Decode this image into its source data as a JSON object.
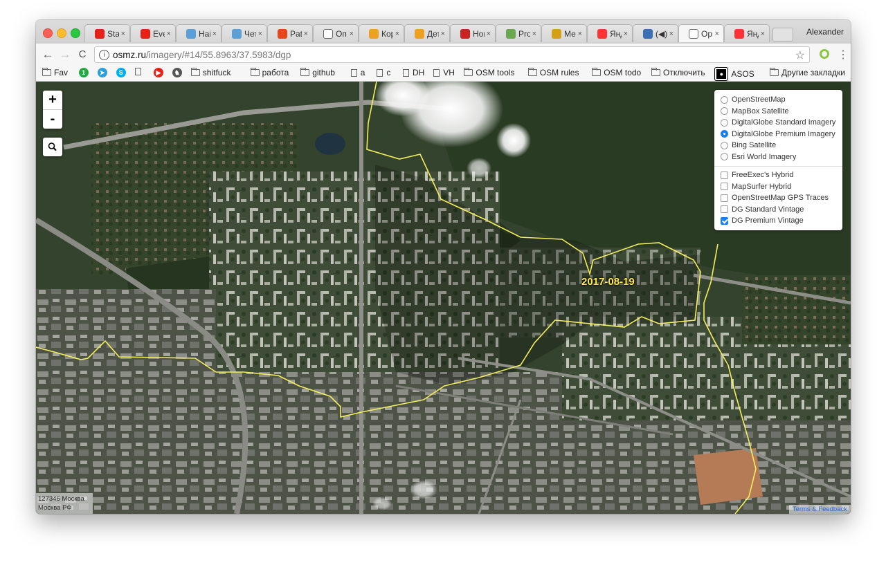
{
  "window": {
    "profile_name": "Alexander",
    "tabs": [
      {
        "title": "Sta",
        "icon": "youtube-icon",
        "color": "#e62117"
      },
      {
        "title": "Eve",
        "icon": "youtube-icon",
        "color": "#e62117"
      },
      {
        "title": "Hai",
        "icon": "hn-icon",
        "color": "#5aa0d8"
      },
      {
        "title": "Чет",
        "icon": "hn-icon",
        "color": "#5aa0d8"
      },
      {
        "title": "Pat",
        "icon": "patreon-icon",
        "color": "#e6461a"
      },
      {
        "title": "Оп",
        "icon": "page-icon",
        "color": "#ffffff"
      },
      {
        "title": "Кор",
        "icon": "cat-icon",
        "color": "#f0a020"
      },
      {
        "title": "Дет",
        "icon": "cat-icon",
        "color": "#f0a020"
      },
      {
        "title": "Hor",
        "icon": "tv-icon",
        "color": "#cc2222"
      },
      {
        "title": "Pro",
        "icon": "tool-icon",
        "color": "#6aa84f"
      },
      {
        "title": "Ме",
        "icon": "train-icon",
        "color": "#d4a017"
      },
      {
        "title": "Янд",
        "icon": "yandex-maps-icon",
        "color": "#f33"
      },
      {
        "title": "(◀)",
        "icon": "video-icon",
        "color": "#3a6fb5"
      },
      {
        "title": "Op",
        "icon": "page-icon",
        "color": "#ffffff",
        "active": true
      },
      {
        "title": "Янд",
        "icon": "yandex-maps-icon",
        "color": "#f33"
      }
    ],
    "tab_close_glyph": "×"
  },
  "toolbar": {
    "back": "←",
    "forward": "→",
    "reload": "C",
    "url_host": "osmz.ru",
    "url_path": "/imagery/#14/55.8963/37.5983/dgp",
    "star": "☆",
    "menu": "⋮"
  },
  "bookmarks": {
    "items": [
      {
        "label": "Fav",
        "type": "folder"
      },
      {
        "label": "",
        "type": "icon",
        "color": "#27a844",
        "glyph": "1"
      },
      {
        "label": "",
        "type": "icon",
        "color": "#2aa0da",
        "glyph": "➤"
      },
      {
        "label": "",
        "type": "icon",
        "color": "#00aff0",
        "glyph": "S"
      },
      {
        "label": "",
        "type": "page"
      },
      {
        "label": "",
        "type": "icon",
        "color": "#e62117",
        "glyph": "▶"
      },
      {
        "label": "",
        "type": "icon",
        "color": "#555555",
        "glyph": "♞"
      },
      {
        "label": "shitfuck",
        "type": "folder"
      },
      {
        "label": "работа",
        "type": "folder"
      },
      {
        "label": "github",
        "type": "folder"
      },
      {
        "label": "a",
        "type": "page"
      },
      {
        "label": "c",
        "type": "page"
      },
      {
        "label": "DH",
        "type": "page"
      },
      {
        "label": "VH",
        "type": "page"
      },
      {
        "label": "OSM tools",
        "type": "folder"
      },
      {
        "label": "OSM rules",
        "type": "folder"
      },
      {
        "label": "OSM todo",
        "type": "folder"
      },
      {
        "label": "Отключить",
        "type": "folder"
      },
      {
        "label": "ASOS",
        "type": "asos"
      }
    ],
    "other": "Другие закладки"
  },
  "map": {
    "zoom_in": "+",
    "zoom_out": "-",
    "search_glyph": "🔍",
    "base_layers": [
      {
        "label": "OpenStreetMap",
        "selected": false
      },
      {
        "label": "MapBox Satellite",
        "selected": false
      },
      {
        "label": "DigitalGlobe Standard Imagery",
        "selected": false
      },
      {
        "label": "DigitalGlobe Premium Imagery",
        "selected": true
      },
      {
        "label": "Bing Satellite",
        "selected": false
      },
      {
        "label": "Esri World Imagery",
        "selected": false
      }
    ],
    "overlays": [
      {
        "label": "FreeExec's Hybrid",
        "checked": false
      },
      {
        "label": "MapSurfer Hybrid",
        "checked": false
      },
      {
        "label": "OpenStreetMap GPS Traces",
        "checked": false
      },
      {
        "label": "DG Standard Vintage",
        "checked": false
      },
      {
        "label": "DG Premium Vintage",
        "checked": true
      }
    ],
    "vintage_date": "2017-08-19",
    "address_line1": "127346 Москва",
    "address_line2": "Москва РФ",
    "attribution": "Terms & Feedback",
    "boundary_color": "#f5ef5a"
  }
}
